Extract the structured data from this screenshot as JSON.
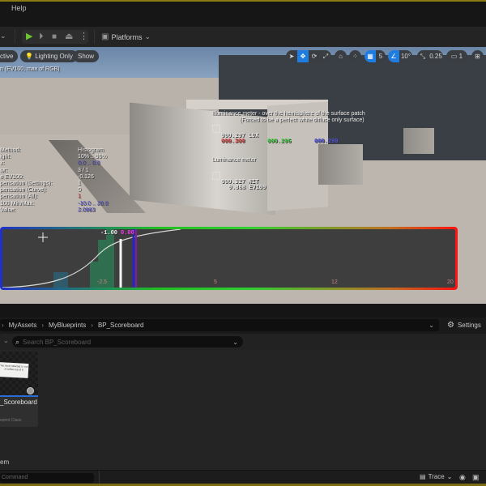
{
  "menu": {
    "help_label": "Help"
  },
  "toolbar": {
    "mode_dropdown_icon": "chevron-down-icon",
    "play_icon": "play-icon",
    "step_icon": "step-forward-icon",
    "stop_icon": "stop-icon",
    "eject_icon": "eject-icon",
    "more_icon": "kebab-icon",
    "platforms_label": "Platforms",
    "platforms_glyph": "▣",
    "play_glyph": "▶",
    "step_glyph": "⏵",
    "stop_glyph": "■",
    "eject_glyph": "⏏",
    "more_glyph": "⋮",
    "chevron_glyph": "⌄"
  },
  "viewport": {
    "view_mode_label": "ctive",
    "lighting_label": "Lighting Only",
    "show_label": "Show",
    "caption": "n (EV100, max of RGB)",
    "right_tools": {
      "grid_value": "5",
      "rotate_value": "10°",
      "scale_value": "0.25",
      "camera_speed": "1"
    },
    "debug_labels": [
      "Method:",
      "ight:",
      "x:",
      "wr:",
      "e EV100:",
      "pensation (Settings):",
      "pensation (Curve):",
      "pensation (All):",
      "100 Min/Max:",
      "Value:"
    ],
    "debug_values": [
      {
        "text": "Histogram",
        "color": "white"
      },
      {
        "text": "10% .. 90%",
        "color": "white"
      },
      {
        "text": "0.0 .. 0.0",
        "color": "blue"
      },
      {
        "text": "3 / 1",
        "color": "white"
      },
      {
        "text": "-0.126",
        "color": "white"
      },
      {
        "text": "1",
        "color": "white"
      },
      {
        "text": "0",
        "color": "white"
      },
      {
        "text": "1",
        "color": "red"
      },
      {
        "text": "-10.0 .. 20.0",
        "color": "blue"
      },
      {
        "text": "2.0863",
        "color": "blue"
      }
    ],
    "illuminance": {
      "title": "Illuminance meter - over the hemisphere of the surface patch",
      "subtitle": "(Forced to be a perfect white diffuse only surface)",
      "value": "000.297 LUX",
      "r": "000.300",
      "g": "000.295",
      "b": "000.290"
    },
    "luminance": {
      "title": "Luminance meter",
      "value": "000.327 NIT",
      "ev": "0.868 EV100"
    },
    "histogram": {
      "marker_white": "-1.00",
      "marker_magenta": "0.00",
      "ticks": [
        "-2.5",
        "5",
        "12",
        "20"
      ]
    }
  },
  "content_browser": {
    "breadcrumb": [
      "MyAssets",
      "MyBlueprints",
      "BP_Scoreboard"
    ],
    "settings_label": "Settings",
    "search_placeholder": "Search BP_Scoreboard",
    "asset": {
      "name": "_Scoreboard",
      "type": "eprint Class",
      "thumb_text": "You have collected 0 / out of coffee cup of 8"
    },
    "status": "em"
  },
  "bottom": {
    "command_placeholder": "Command",
    "trace_label": "Trace"
  }
}
